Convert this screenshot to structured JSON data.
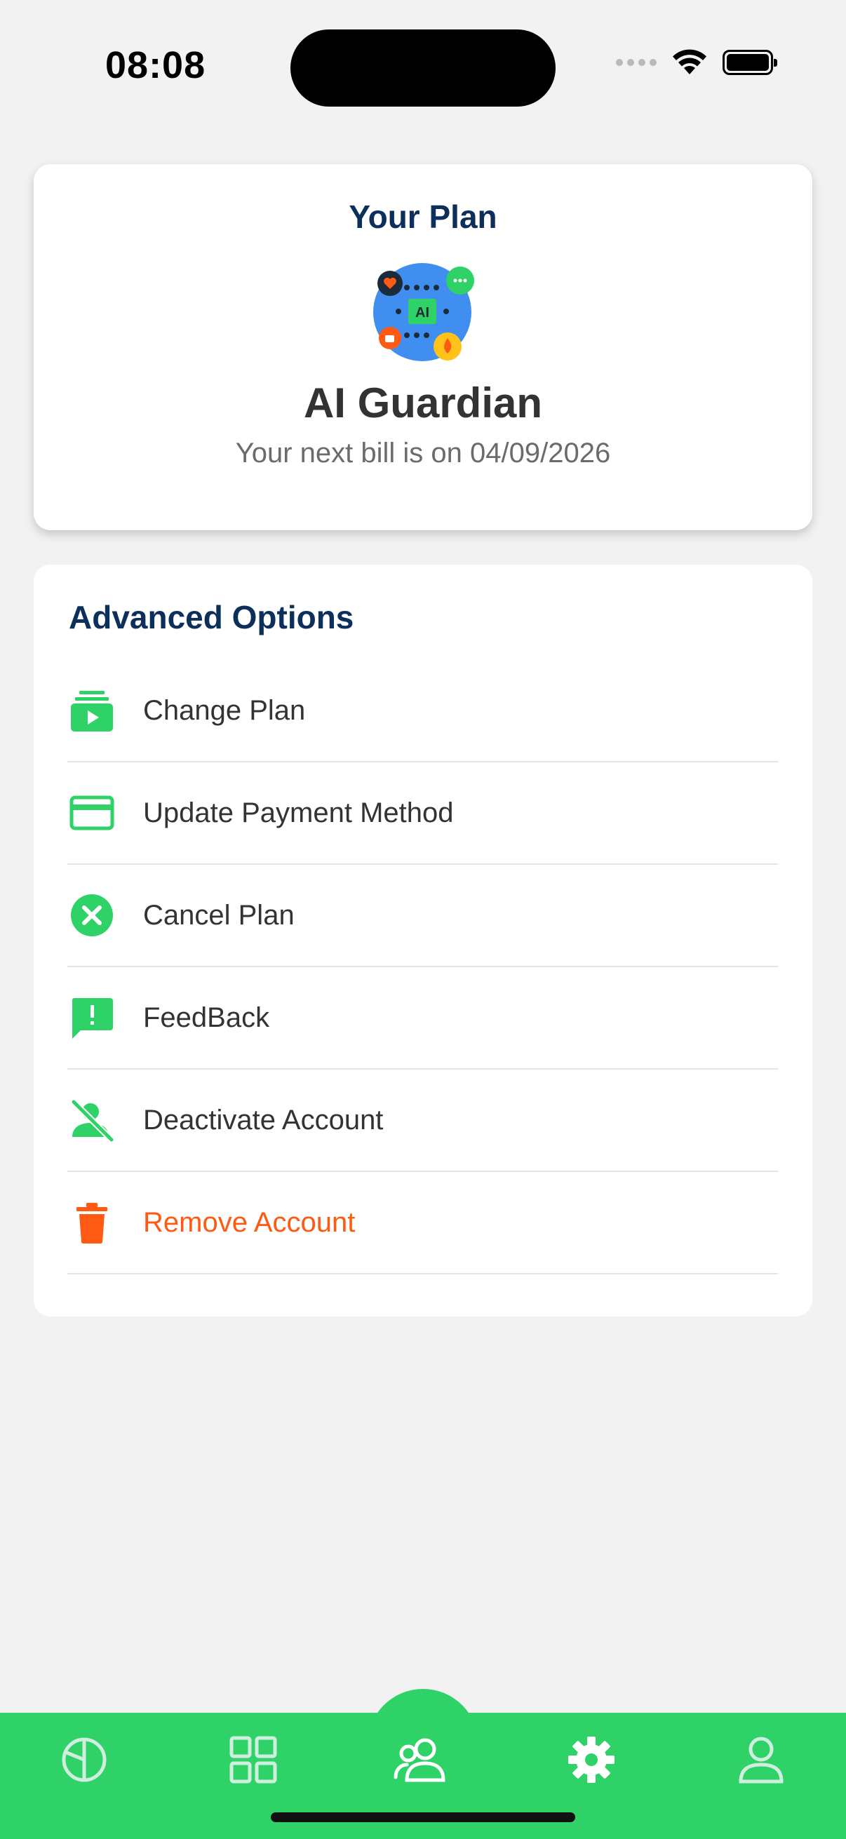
{
  "status_bar": {
    "time": "08:08"
  },
  "plan": {
    "title": "Your Plan",
    "name": "AI Guardian",
    "next_bill": "Your next bill is on 04/09/2026",
    "logo_icon": "ai-guardian-logo-icon",
    "logo_text": "AI"
  },
  "options": {
    "title": "Advanced Options",
    "items": [
      {
        "label": "Change Plan",
        "icon": "change-plan-icon"
      },
      {
        "label": "Update Payment Method",
        "icon": "credit-card-icon"
      },
      {
        "label": "Cancel Plan",
        "icon": "cancel-circle-icon"
      },
      {
        "label": "FeedBack",
        "icon": "feedback-icon"
      },
      {
        "label": "Deactivate Account",
        "icon": "person-off-icon"
      },
      {
        "label": "Remove Account",
        "icon": "trash-icon"
      }
    ]
  },
  "bottom_nav": {
    "items": [
      {
        "icon": "pie-chart-icon"
      },
      {
        "icon": "grid-icon"
      },
      {
        "icon": "users-icon",
        "active": true
      },
      {
        "icon": "gear-icon"
      },
      {
        "icon": "profile-icon"
      }
    ]
  },
  "colors": {
    "accent_green": "#2ed267",
    "title_navy": "#0c2f5c",
    "danger_orange": "#ff5a14",
    "background": "#f2f2f3"
  }
}
